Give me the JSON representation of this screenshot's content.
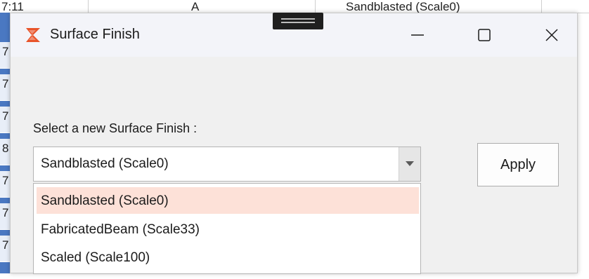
{
  "background": {
    "top_row": [
      "7:11",
      "A",
      "Sandblasted (Scale0)"
    ],
    "left_cells": [
      "7",
      "7",
      "7",
      "8",
      "7",
      "7",
      "7"
    ]
  },
  "dialog": {
    "title": "Surface Finish",
    "prompt": "Select a new Surface Finish :",
    "selected_value": "Sandblasted (Scale0)",
    "options": [
      {
        "label": "Sandblasted (Scale0)",
        "highlighted": true
      },
      {
        "label": "FabricatedBeam (Scale33)",
        "highlighted": false
      },
      {
        "label": "Scaled (Scale100)",
        "highlighted": false
      }
    ],
    "apply_label": "Apply",
    "icons": {
      "app": "app-logo-icon",
      "minimize": "minimize-icon",
      "maximize": "maximize-icon",
      "close": "close-icon",
      "dropdown": "chevron-down-icon"
    }
  },
  "colors": {
    "accent": "#e8542a",
    "highlight": "#fde1d8",
    "selection_strip": "#4a78c2"
  }
}
